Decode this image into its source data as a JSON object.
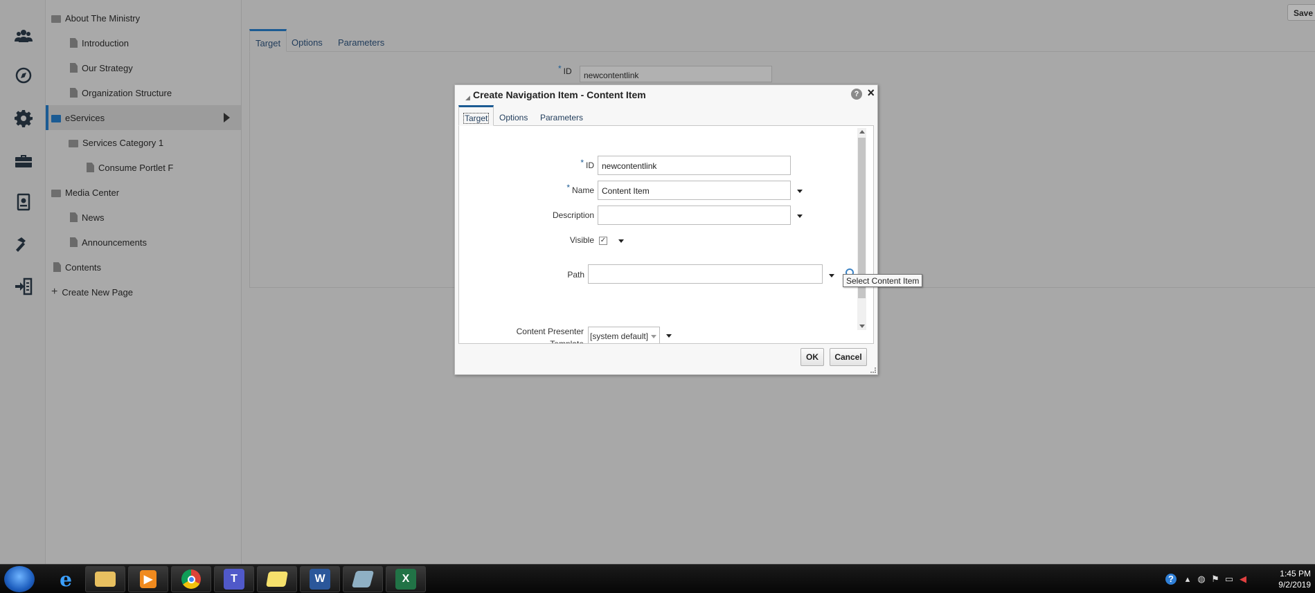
{
  "rail": {
    "icons": [
      "people-icon",
      "compass-icon",
      "gear-icon",
      "toolbox-icon",
      "report-icon",
      "hammer-icon",
      "exit-panel-icon"
    ]
  },
  "tree": {
    "items": [
      {
        "label": "About The Ministry",
        "type": "folder"
      },
      {
        "label": "Introduction",
        "type": "page"
      },
      {
        "label": "Our Strategy",
        "type": "page"
      },
      {
        "label": "Organization Structure",
        "type": "page"
      },
      {
        "label": "eServices",
        "type": "folder",
        "selected": true
      },
      {
        "label": "Services Category 1",
        "type": "folder"
      },
      {
        "label": "Consume Portlet F",
        "type": "page"
      },
      {
        "label": "Media Center",
        "type": "folder"
      },
      {
        "label": "News",
        "type": "page"
      },
      {
        "label": "Announcements",
        "type": "page"
      },
      {
        "label": "Contents",
        "type": "page"
      }
    ],
    "create_new_page": "Create New Page"
  },
  "main": {
    "save_label": "Save",
    "tabs": [
      {
        "label": "Target",
        "active": true
      },
      {
        "label": "Options"
      },
      {
        "label": "Parameters"
      }
    ],
    "id_label": "ID",
    "id_value": "newcontentlink"
  },
  "dialog": {
    "title": "Create Navigation Item - Content Item",
    "help": "?",
    "close": "×",
    "tabs": [
      {
        "label": "Target",
        "active": true
      },
      {
        "label": "Options"
      },
      {
        "label": "Parameters"
      }
    ],
    "fields": {
      "id_label": "ID",
      "id_value": "newcontentlink",
      "name_label": "Name",
      "name_value": "Content Item",
      "description_label": "Description",
      "description_value": "",
      "visible_label": "Visible",
      "visible_checked": true,
      "path_label": "Path",
      "path_value": "",
      "template_label_line1": "Content Presenter",
      "template_label_line2": "Template",
      "template_value": "[system default]"
    },
    "ok_label": "OK",
    "cancel_label": "Cancel",
    "tooltip": "Select Content Item"
  },
  "taskbar": {
    "apps": [
      "internet-explorer",
      "file-explorer",
      "media-player",
      "chrome",
      "teams",
      "sticky-notes",
      "word",
      "pen-tablet",
      "excel"
    ],
    "clock_time": "1:45 PM",
    "clock_date": "9/2/2019"
  },
  "colors": {
    "accent": "#1b5b93",
    "overlay_gray": "#a8a8a8",
    "dialog_bg": "#f7f7f7"
  }
}
